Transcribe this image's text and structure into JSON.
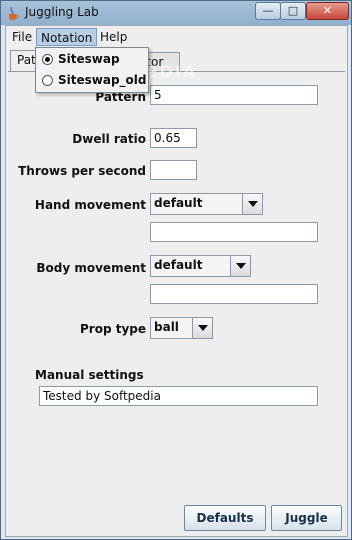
{
  "window": {
    "title": "Juggling Lab",
    "minimize_glyph": "—",
    "maximize_glyph": "□",
    "close_glyph": "✕"
  },
  "menubar": {
    "items": [
      "File",
      "Notation",
      "Help"
    ]
  },
  "tabs": {
    "items": [
      "Pat",
      "ator"
    ]
  },
  "notation_menu": {
    "options": [
      {
        "label": "Siteswap",
        "selected": true
      },
      {
        "label": "Siteswap_old",
        "selected": false
      }
    ]
  },
  "form": {
    "pattern_label": "Pattern",
    "pattern_value": "5",
    "dwell_label": "Dwell ratio",
    "dwell_value": "0.65",
    "throws_label": "Throws per second",
    "throws_value": "",
    "hand_label": "Hand movement",
    "hand_value": "default",
    "hand_custom": "",
    "body_label": "Body movement",
    "body_value": "default",
    "body_custom": "",
    "prop_label": "Prop type",
    "prop_value": "ball",
    "manual_label": "Manual settings",
    "manual_value": "Tested by Softpedia"
  },
  "buttons": {
    "defaults": "Defaults",
    "juggle": "Juggle"
  },
  "watermark": "SOFTPEDIA"
}
